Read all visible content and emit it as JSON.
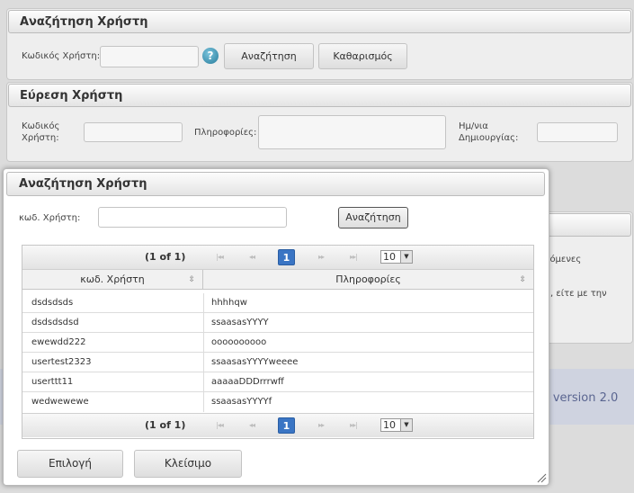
{
  "search_panel": {
    "title": "Αναζήτηση Χρήστη",
    "code_label": "Κωδικός Χρήστη:",
    "help_icon": "?",
    "search_button": "Αναζήτηση",
    "clear_button": "Καθαρισμός"
  },
  "find_panel": {
    "title": "Εύρεση Χρήστη",
    "code_label_line1": "Κωδικός",
    "code_label_line2": "Χρήστη:",
    "info_label": "Πληροφορίες:",
    "date_label_line1": "Ημ/νια",
    "date_label_line2": "Δημιουργίας:"
  },
  "background": {
    "text_right_1": "ζόμενες",
    "text_right_2": ", είτε με την",
    "version_text": "- version 2.0"
  },
  "dialog": {
    "title": "Αναζήτηση Χρήστη",
    "code_label": "κωδ. Χρήστη:",
    "search_button": "Αναζήτηση",
    "pager": {
      "page_info": "(1 of 1)",
      "first": "|◂◂",
      "prev": "◂◂",
      "current_page": "1",
      "next": "▸▸",
      "last": "▸▸|",
      "rows_per_page": "10",
      "dropdown_arrow": "▼"
    },
    "columns": [
      "κωδ. Χρήστη",
      "Πληροφορίες"
    ],
    "sort_icon": "⇳",
    "rows": [
      {
        "code": "dsdsdsds",
        "info": "hhhhqw"
      },
      {
        "code": "dsdsdsdsd",
        "info": "ssaasasYYYY"
      },
      {
        "code": "ewewdd222",
        "info": "oooooooooo"
      },
      {
        "code": "usertest2323",
        "info": "ssaasasYYYYweeee"
      },
      {
        "code": "userttt11",
        "info": "aaaaaDDDrrrwff"
      },
      {
        "code": "wedwewewe",
        "info": "ssaasasYYYYf"
      }
    ],
    "select_button": "Επιλογή",
    "close_button": "Κλείσιμο"
  }
}
